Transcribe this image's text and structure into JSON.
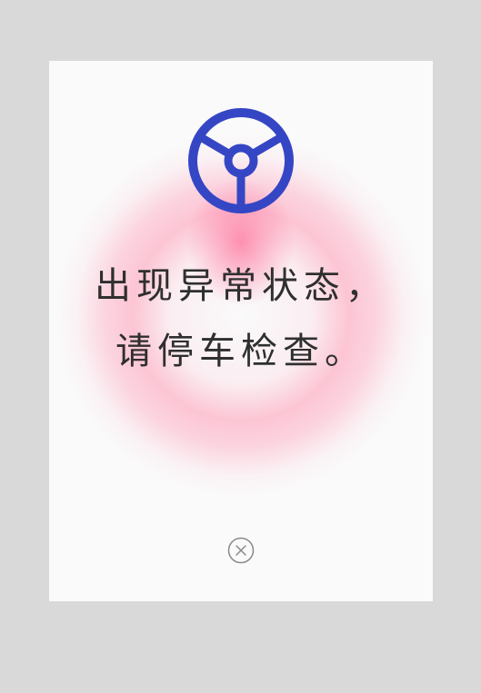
{
  "dialog": {
    "icon": "steering-wheel-icon",
    "message": "出现异常状态，请停车检查。",
    "close_icon": "close-circle-icon"
  },
  "colors": {
    "page_background": "#d9d9d9",
    "card_background": "#fafafa",
    "icon_color": "#3546c5",
    "text_color": "#2f2f2f",
    "glow_color": "#ff6e96",
    "close_color": "#8a8a8a"
  }
}
